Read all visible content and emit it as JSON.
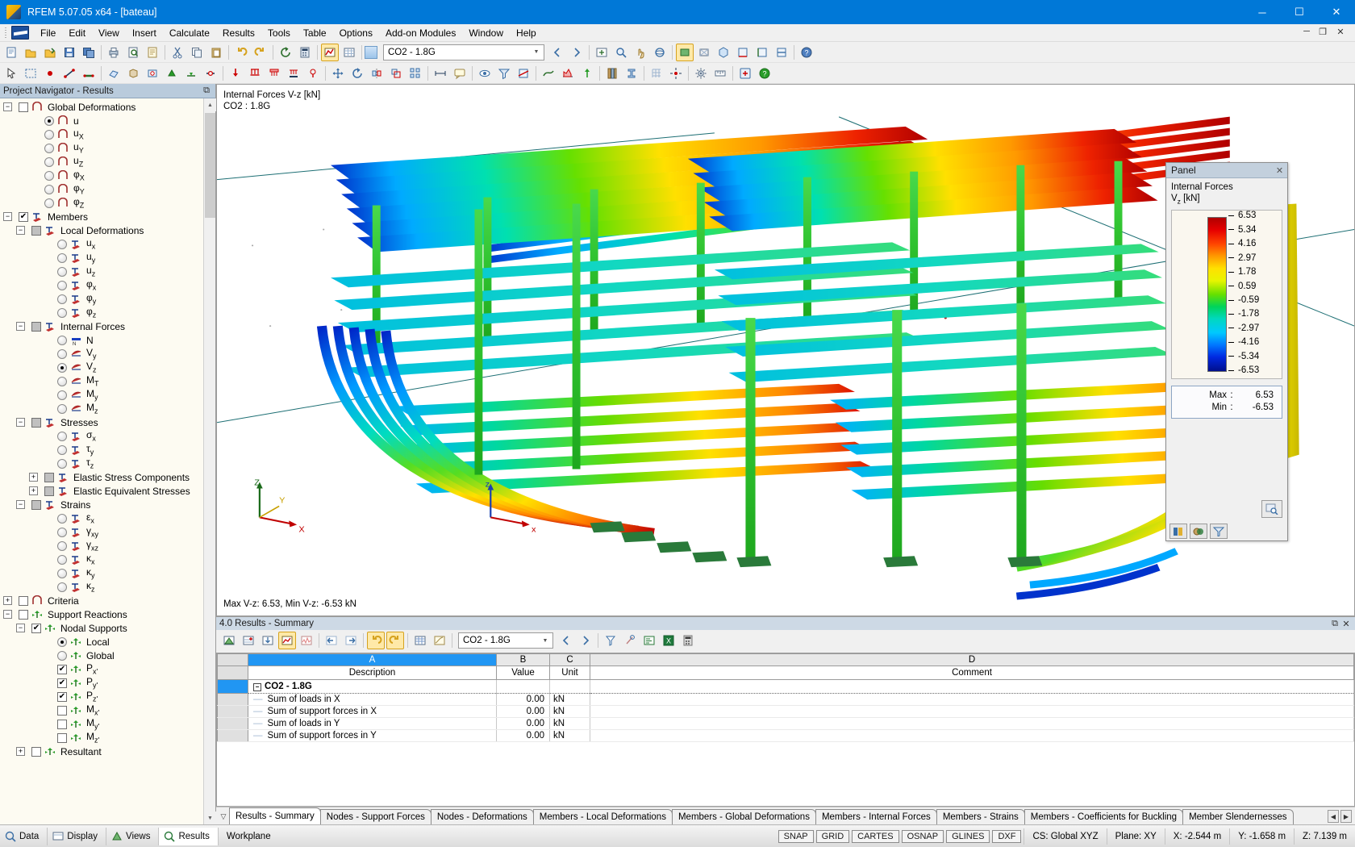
{
  "window": {
    "title": "RFEM 5.07.05 x64 - [bateau]",
    "minimize": "─",
    "maximize": "☐",
    "close": "✕"
  },
  "menubar": {
    "items": [
      "File",
      "Edit",
      "View",
      "Insert",
      "Calculate",
      "Results",
      "Tools",
      "Table",
      "Options",
      "Add-on Modules",
      "Window",
      "Help"
    ],
    "doc_minimize": "─",
    "doc_restore": "❐",
    "doc_close": "✕"
  },
  "toolbar": {
    "load_case_value": "CO2 - 1.8G",
    "dropdown_arrow": "▼"
  },
  "navigator": {
    "title": "Project Navigator - Results",
    "pin": "⧉",
    "tree": [
      {
        "label": "Global Deformations",
        "indent": 0,
        "control": "check",
        "checked": false,
        "icon": "surface",
        "expander": "-"
      },
      {
        "label": "u",
        "indent": 2,
        "control": "radio",
        "selected": true,
        "icon": "surface"
      },
      {
        "label": "u",
        "sub": "X",
        "indent": 2,
        "control": "radio",
        "selected": false,
        "icon": "surface"
      },
      {
        "label": "u",
        "sub": "Y",
        "indent": 2,
        "control": "radio",
        "selected": false,
        "icon": "surface"
      },
      {
        "label": "u",
        "sub": "Z",
        "indent": 2,
        "control": "radio",
        "selected": false,
        "icon": "surface"
      },
      {
        "label": "φ",
        "sub": "X",
        "indent": 2,
        "control": "radio",
        "selected": false,
        "icon": "surface"
      },
      {
        "label": "φ",
        "sub": "Y",
        "indent": 2,
        "control": "radio",
        "selected": false,
        "icon": "surface"
      },
      {
        "label": "φ",
        "sub": "Z",
        "indent": 2,
        "control": "radio",
        "selected": false,
        "icon": "surface"
      },
      {
        "label": "Members",
        "indent": 0,
        "control": "check",
        "checked": true,
        "icon": "member",
        "expander": "-"
      },
      {
        "label": "Local Deformations",
        "indent": 1,
        "control": "check",
        "gray": true,
        "icon": "member",
        "expander": "-"
      },
      {
        "label": "u",
        "sub": "x",
        "indent": 3,
        "control": "radio",
        "selected": false,
        "icon": "member"
      },
      {
        "label": "u",
        "sub": "y",
        "indent": 3,
        "control": "radio",
        "selected": false,
        "icon": "member"
      },
      {
        "label": "u",
        "sub": "z",
        "indent": 3,
        "control": "radio",
        "selected": false,
        "icon": "member"
      },
      {
        "label": "φ",
        "sub": "x",
        "indent": 3,
        "control": "radio",
        "selected": false,
        "icon": "member"
      },
      {
        "label": "φ",
        "sub": "y",
        "indent": 3,
        "control": "radio",
        "selected": false,
        "icon": "member"
      },
      {
        "label": "φ",
        "sub": "z",
        "indent": 3,
        "control": "radio",
        "selected": false,
        "icon": "member"
      },
      {
        "label": "Internal Forces",
        "indent": 1,
        "control": "check",
        "gray": true,
        "icon": "member",
        "expander": "-"
      },
      {
        "label": "N",
        "indent": 3,
        "control": "radio",
        "selected": false,
        "icon": "diagN"
      },
      {
        "label": "V",
        "sub": "y",
        "indent": 3,
        "control": "radio",
        "selected": false,
        "icon": "diagV"
      },
      {
        "label": "V",
        "sub": "z",
        "indent": 3,
        "control": "radio",
        "selected": true,
        "icon": "diagV"
      },
      {
        "label": "M",
        "sub": "T",
        "indent": 3,
        "control": "radio",
        "selected": false,
        "icon": "diagV"
      },
      {
        "label": "M",
        "sub": "y",
        "indent": 3,
        "control": "radio",
        "selected": false,
        "icon": "diagV"
      },
      {
        "label": "M",
        "sub": "z",
        "indent": 3,
        "control": "radio",
        "selected": false,
        "icon": "diagV"
      },
      {
        "label": "Stresses",
        "indent": 1,
        "control": "check",
        "gray": true,
        "icon": "member",
        "expander": "-"
      },
      {
        "label": "σ",
        "sub": "x",
        "indent": 3,
        "control": "radio",
        "selected": false,
        "icon": "member"
      },
      {
        "label": "τ",
        "sub": "y",
        "indent": 3,
        "control": "radio",
        "selected": false,
        "icon": "member"
      },
      {
        "label": "τ",
        "sub": "z",
        "indent": 3,
        "control": "radio",
        "selected": false,
        "icon": "member"
      },
      {
        "label": "Elastic Stress Components",
        "indent": 2,
        "control": "check",
        "gray": true,
        "icon": "member",
        "expander": "+"
      },
      {
        "label": "Elastic Equivalent Stresses",
        "indent": 2,
        "control": "check",
        "gray": true,
        "icon": "member",
        "expander": "+"
      },
      {
        "label": "Strains",
        "indent": 1,
        "control": "check",
        "gray": true,
        "icon": "member",
        "expander": "-"
      },
      {
        "label": "ε",
        "sub": "x",
        "indent": 3,
        "control": "radio",
        "selected": false,
        "icon": "member"
      },
      {
        "label": "γ",
        "sub": "xy",
        "indent": 3,
        "control": "radio",
        "selected": false,
        "icon": "member"
      },
      {
        "label": "γ",
        "sub": "xz",
        "indent": 3,
        "control": "radio",
        "selected": false,
        "icon": "member"
      },
      {
        "label": "κ",
        "sub": "x",
        "indent": 3,
        "control": "radio",
        "selected": false,
        "icon": "member"
      },
      {
        "label": "κ",
        "sub": "y",
        "indent": 3,
        "control": "radio",
        "selected": false,
        "icon": "member"
      },
      {
        "label": "κ",
        "sub": "z",
        "indent": 3,
        "control": "radio",
        "selected": false,
        "icon": "member"
      },
      {
        "label": "Criteria",
        "indent": 0,
        "control": "check",
        "checked": false,
        "icon": "surface",
        "expander": "+"
      },
      {
        "label": "Support Reactions",
        "indent": 0,
        "control": "check",
        "checked": false,
        "icon": "support",
        "expander": "-"
      },
      {
        "label": "Nodal Supports",
        "indent": 1,
        "control": "check",
        "checked": true,
        "icon": "support",
        "expander": "-"
      },
      {
        "label": "Local",
        "indent": 3,
        "control": "radio",
        "selected": true,
        "icon": "support"
      },
      {
        "label": "Global",
        "indent": 3,
        "control": "radio",
        "selected": false,
        "icon": "support"
      },
      {
        "label": "P",
        "sub": "x'",
        "indent": 3,
        "control": "check",
        "checked": true,
        "icon": "support"
      },
      {
        "label": "P",
        "sub": "y'",
        "indent": 3,
        "control": "check",
        "checked": true,
        "icon": "support"
      },
      {
        "label": "P",
        "sub": "z'",
        "indent": 3,
        "control": "check",
        "checked": true,
        "icon": "support"
      },
      {
        "label": "M",
        "sub": "x'",
        "indent": 3,
        "control": "check",
        "checked": false,
        "icon": "support"
      },
      {
        "label": "M",
        "sub": "y'",
        "indent": 3,
        "control": "check",
        "checked": false,
        "icon": "support"
      },
      {
        "label": "M",
        "sub": "z'",
        "indent": 3,
        "control": "check",
        "checked": false,
        "icon": "support"
      },
      {
        "label": "Resultant",
        "indent": 1,
        "control": "check",
        "checked": false,
        "icon": "support",
        "expander": "+"
      }
    ]
  },
  "viewport": {
    "result_label_line1": "Internal Forces V-z [kN]",
    "result_label_line2": "CO2 : 1.8G",
    "maxmin_text": "Max V-z: 6.53, Min V-z: -6.53 kN",
    "axis_x": "X",
    "axis_y": "Y",
    "axis_z": "Z",
    "local_axis_x": "x",
    "local_axis_z": "z"
  },
  "panel": {
    "title": "Panel",
    "close": "✕",
    "heading": "Internal Forces",
    "quantity": "V",
    "quantity_sub": "z",
    "unit": "[kN]",
    "scale_values": [
      "6.53",
      "5.34",
      "4.16",
      "2.97",
      "1.78",
      "0.59",
      "-0.59",
      "-1.78",
      "-2.97",
      "-4.16",
      "-5.34",
      "-6.53"
    ],
    "max_label": "Max",
    "max_value": "6.53",
    "min_label": "Min",
    "min_value": "-6.53",
    "colon": ":"
  },
  "table_panel": {
    "title": "4.0 Results - Summary",
    "pin": "⧉",
    "close": "✕",
    "load_case_value": "CO2 - 1.8G",
    "dropdown_arrow": "▼",
    "column_letters": [
      "",
      "A",
      "B",
      "C",
      "D"
    ],
    "column_headers": [
      "",
      "Description",
      "Value",
      "Unit",
      "Comment"
    ],
    "group_row": "CO2 - 1.8G",
    "rows": [
      {
        "description": "Sum of loads in X",
        "value": "0.00",
        "unit": "kN",
        "comment": ""
      },
      {
        "description": "Sum of support forces in X",
        "value": "0.00",
        "unit": "kN",
        "comment": ""
      },
      {
        "description": "Sum of loads in Y",
        "value": "0.00",
        "unit": "kN",
        "comment": ""
      },
      {
        "description": "Sum of support forces in Y",
        "value": "0.00",
        "unit": "kN",
        "comment": ""
      }
    ]
  },
  "tabs": {
    "items": [
      "Results - Summary",
      "Nodes - Support Forces",
      "Nodes - Deformations",
      "Members - Local Deformations",
      "Members - Global Deformations",
      "Members - Internal Forces",
      "Members - Strains",
      "Members - Coefficients for Buckling",
      "Member Slendernesses"
    ],
    "active_index": 0,
    "prev": "◀",
    "next": "▶"
  },
  "statusbar": {
    "data_tab": "Data",
    "display_tab": "Display",
    "views_tab": "Views",
    "results_tab": "Results",
    "workplane": "Workplane",
    "flags": [
      "SNAP",
      "GRID",
      "CARTES",
      "OSNAP",
      "GLINES",
      "DXF"
    ],
    "cs": "CS: Global XYZ",
    "plane": "Plane: XY",
    "coord_x": "X:  -2.544 m",
    "coord_y": "Y:  -1.658 m",
    "coord_z": "Z:  7.139 m"
  },
  "chart_data": {
    "type": "heatmap",
    "title": "Internal Forces V-z [kN]",
    "subtitle": "CO2 : 1.8G",
    "legend_position": "right-panel",
    "colorbar_label": "Vz [kN]",
    "colorbar_ticks": [
      6.53,
      5.34,
      4.16,
      2.97,
      1.78,
      0.59,
      -0.59,
      -1.78,
      -2.97,
      -4.16,
      -5.34,
      -6.53
    ],
    "vmin": -6.53,
    "vmax": 6.53,
    "max_value": 6.53,
    "min_value": -6.53,
    "unit": "kN"
  },
  "colors": {
    "accent": "#0078d7",
    "panel_header": "#c3d0dd",
    "selection": "#2196f3",
    "legend_max": "#b00000",
    "legend_min": "#000f8c"
  }
}
